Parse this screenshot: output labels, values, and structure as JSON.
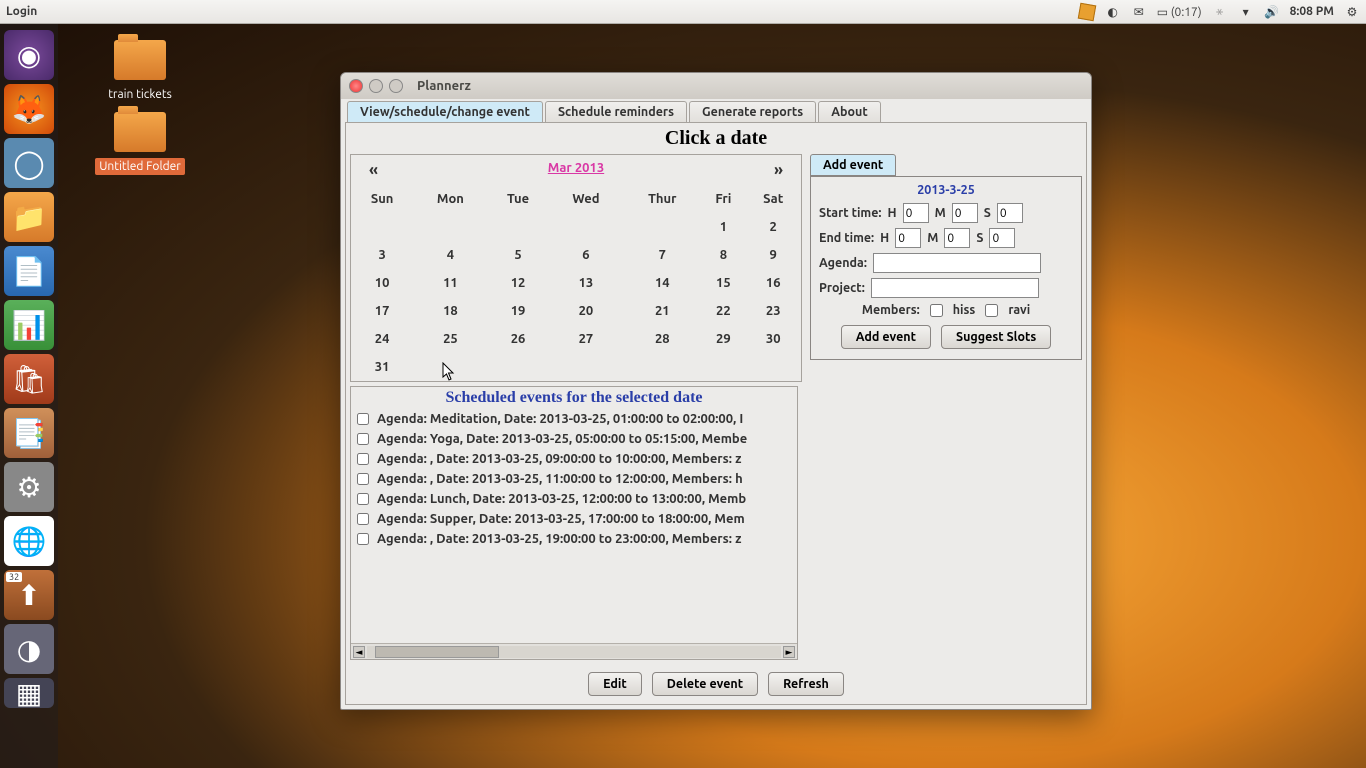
{
  "panel": {
    "menu": "Login",
    "battery": "(0:17)",
    "time": "8:08 PM"
  },
  "desktop": {
    "icon1": "train tickets",
    "icon2": "Untitled Folder"
  },
  "window": {
    "title": "Plannerz",
    "tabs": [
      "View/schedule/change event",
      "Schedule reminders",
      "Generate reports",
      "About"
    ],
    "clickDate": "Click a date",
    "prev": "«",
    "next": "»",
    "month": "Mar 2013",
    "days": [
      "Sun",
      "Mon",
      "Tue",
      "Wed",
      "Thur",
      "Fri",
      "Sat"
    ],
    "weeks": [
      [
        "",
        "",
        "",
        "",
        "",
        "1",
        "2"
      ],
      [
        "3",
        "4",
        "5",
        "6",
        "7",
        "8",
        "9"
      ],
      [
        "10",
        "11",
        "12",
        "13",
        "14",
        "15",
        "16"
      ],
      [
        "17",
        "18",
        "19",
        "20",
        "21",
        "22",
        "23"
      ],
      [
        "24",
        "25",
        "26",
        "27",
        "28",
        "29",
        "30"
      ],
      [
        "31",
        "",
        "",
        "",
        "",
        "",
        ""
      ]
    ],
    "addEventTab": "Add event",
    "form": {
      "date": "2013-3-25",
      "startLabel": "Start time:",
      "endLabel": "End time:",
      "H": "H",
      "M": "M",
      "S": "S",
      "sh": "0",
      "sm": "0",
      "ss": "0",
      "eh": "0",
      "em": "0",
      "es": "0",
      "agendaLabel": "Agenda:",
      "projectLabel": "Project:",
      "membersLabel": "Members:",
      "member1": "hiss",
      "member2": "ravi",
      "addBtn": "Add event",
      "suggestBtn": "Suggest Slots"
    },
    "eventsTitle": "Scheduled events for the selected date",
    "events": [
      "Agenda: Meditation, Date: 2013-03-25, 01:00:00 to 02:00:00, I",
      "Agenda: Yoga, Date: 2013-03-25, 05:00:00 to 05:15:00, Membe",
      "Agenda: , Date: 2013-03-25, 09:00:00 to 10:00:00, Members: z",
      "Agenda: , Date: 2013-03-25, 11:00:00 to 12:00:00, Members: h",
      "Agenda: Lunch, Date: 2013-03-25, 12:00:00 to 13:00:00, Memb",
      "Agenda: Supper, Date: 2013-03-25, 17:00:00 to 18:00:00, Mem",
      "Agenda: , Date: 2013-03-25, 19:00:00 to 23:00:00, Members: z"
    ],
    "editBtn": "Edit",
    "deleteBtn": "Delete event",
    "refreshBtn": "Refresh"
  },
  "launcher_badge": "32"
}
